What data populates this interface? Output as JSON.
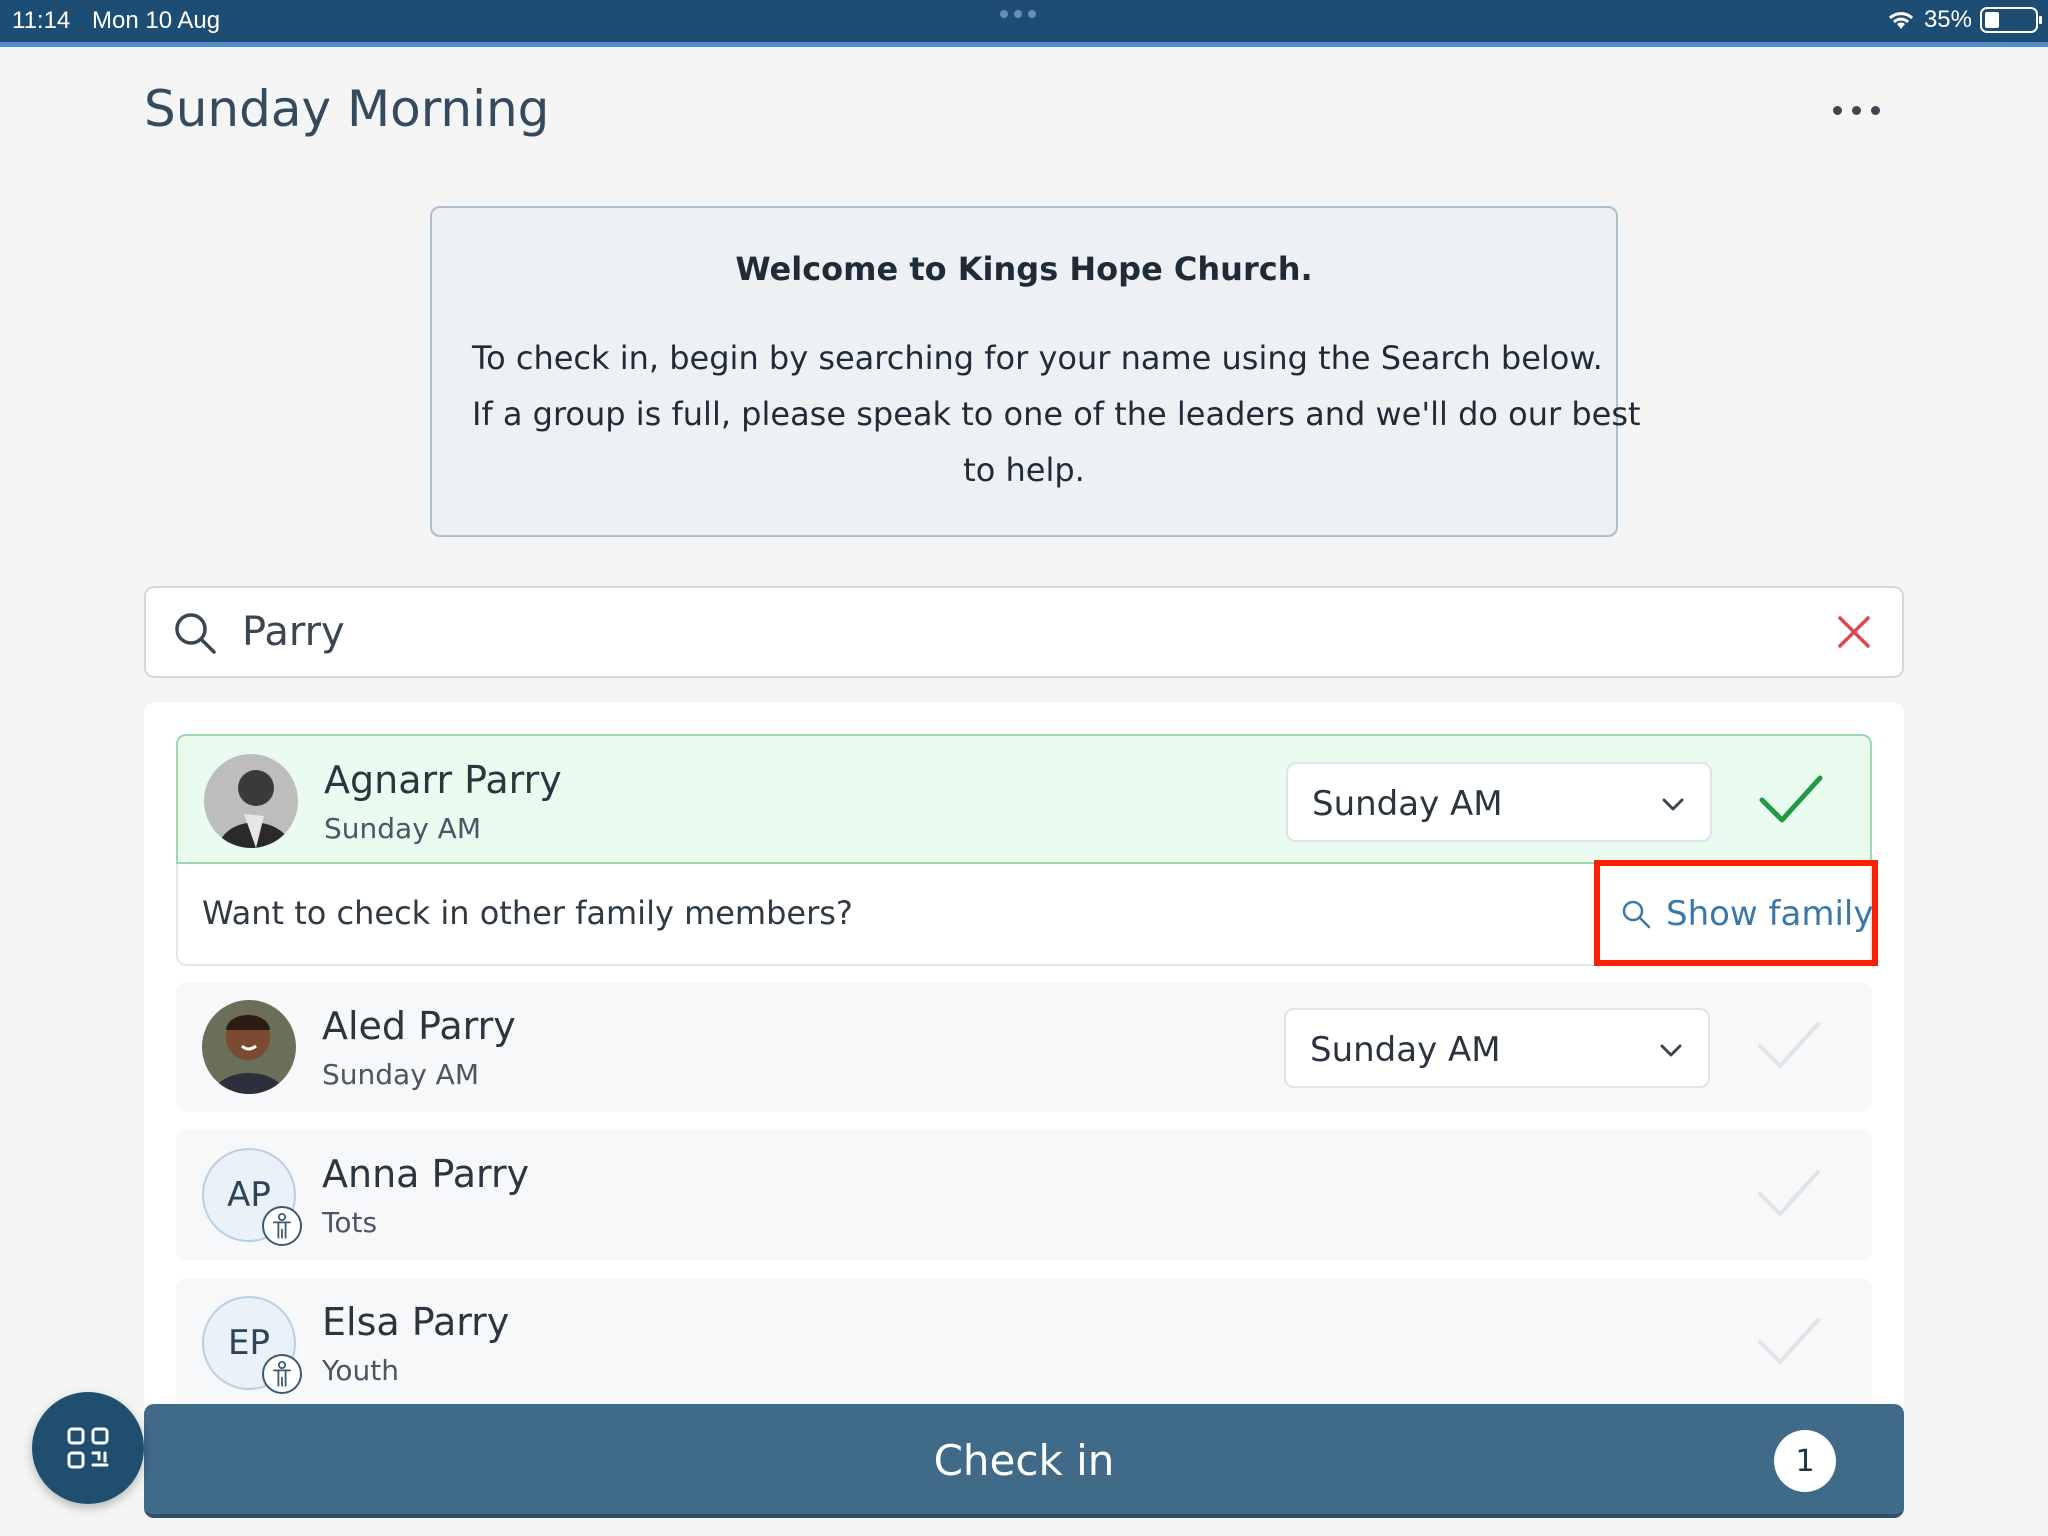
{
  "status_bar": {
    "time": "11:14",
    "date": "Mon 10 Aug",
    "battery": "35%"
  },
  "header": {
    "title": "Sunday Morning",
    "more_icon": "more-horizontal-icon"
  },
  "welcome": {
    "title": "Welcome to Kings Hope Church.",
    "lines": [
      "To check in, begin by searching for your name using the Search below.",
      "If a group is full, please speak to one of the leaders and we'll do our best",
      "to help."
    ]
  },
  "search": {
    "value": "Parry",
    "icon": "search-icon",
    "clear_icon": "close-icon",
    "clear_color": "#e0454f"
  },
  "people": [
    {
      "name": "Agnarr Parry",
      "group": "Sunday AM",
      "select": "Sunday AM",
      "selected": true,
      "avatar": "photo"
    },
    {
      "name": "Aled Parry",
      "group": "Sunday AM",
      "select": "Sunday AM",
      "selected": false,
      "avatar": "photo"
    },
    {
      "name": "Anna Parry",
      "group": "Tots",
      "initials": "AP",
      "selected": false,
      "avatar": "initials-child"
    },
    {
      "name": "Elsa Parry",
      "group": "Youth",
      "initials": "EP",
      "selected": false,
      "avatar": "initials-child"
    }
  ],
  "family_prompt": {
    "text": "Want to check in other family members?",
    "button_label": "Show family"
  },
  "checkin": {
    "label": "Check in",
    "count": "1"
  },
  "colors": {
    "accent": "#1e4d73",
    "checkin_bar": "#3f6a88",
    "selected_row": "#eafcf0",
    "check_green": "#1f9a45",
    "highlight": "#ff1f00"
  }
}
